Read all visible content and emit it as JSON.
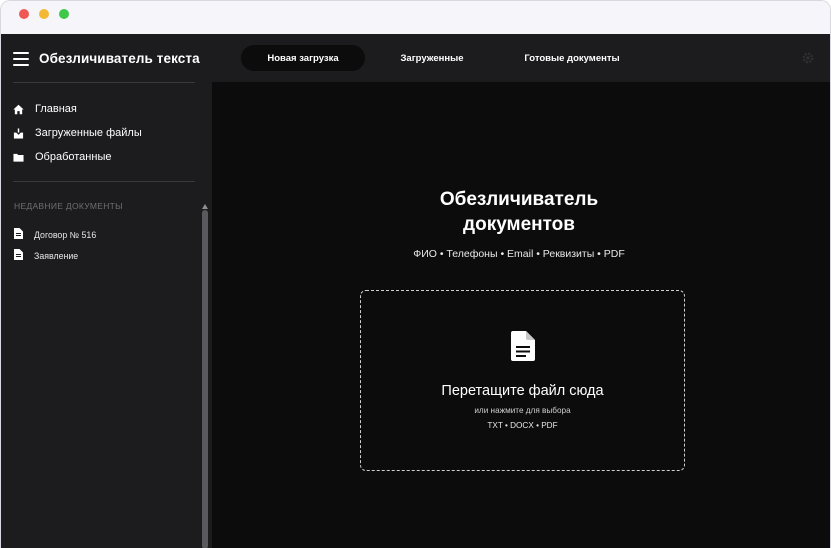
{
  "app": {
    "title": "Обезличиватель текста"
  },
  "sidebar": {
    "nav": [
      {
        "label": "Главная",
        "icon": "home-icon"
      },
      {
        "label": "Загруженные файлы",
        "icon": "download-box-icon"
      },
      {
        "label": "Обработанные",
        "icon": "folder-icon"
      }
    ],
    "recent_heading": "НЕДАВНИЕ ДОКУМЕНТЫ",
    "recent": [
      {
        "label": "Договор № 516",
        "icon": "document-icon"
      },
      {
        "label": "Заявление",
        "icon": "document-icon"
      }
    ]
  },
  "tabs": [
    {
      "label": "Новая загрузка",
      "active": true
    },
    {
      "label": "Загруженные",
      "active": false
    },
    {
      "label": "Готовые документы",
      "active": false
    }
  ],
  "main": {
    "title_line1": "Обезличиватель",
    "title_line2": "документов",
    "subtitle": "ФИО • Телефоны • Email • Реквизиты • PDF",
    "dropzone": {
      "title": "Перетащите файл сюда",
      "hint": "или нажмите для выбора",
      "formats": "TXT • DOCX • PDF",
      "icon": "file-document-icon"
    }
  },
  "colors": {
    "sidebar_bg": "#1c1c1e",
    "main_bg": "#0c0c0d",
    "active_tab_bg": "#0c0c0d",
    "text": "#ffffff"
  }
}
